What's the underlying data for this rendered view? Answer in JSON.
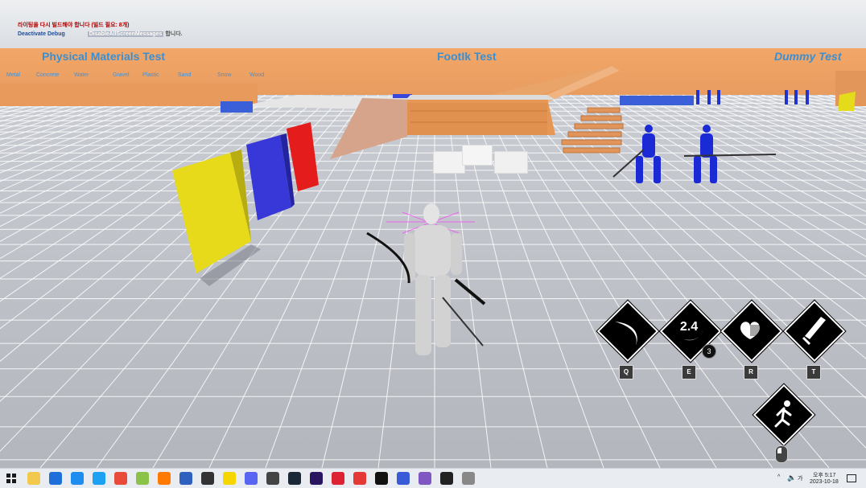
{
  "debug": {
    "rebuild_warning": "라이팅을 다시 빌드해야 합니다 (빌드 필요: 8개)",
    "deactivate_label": "Deactivate Debug",
    "deactivate_tail": "DisableAllScreenMessages",
    "deactivate_suffix": "합니다."
  },
  "zones": {
    "physical": "Physical Materials Test",
    "footik": "FootIk Test",
    "dummy": "Dummy Test"
  },
  "materials": [
    "Metal",
    "Concrete",
    "Water",
    "Gravel",
    "Plastic",
    "Sand",
    "Snow",
    "Wood"
  ],
  "skills": [
    {
      "key": "Q",
      "icon": "slash-icon"
    },
    {
      "key": "E",
      "icon": "moon-slash-icon",
      "timer": "2.4",
      "stack": "3"
    },
    {
      "key": "R",
      "icon": "heart-shield-icon"
    },
    {
      "key": "T",
      "icon": "sword-icon"
    }
  ],
  "sprint": {
    "icon": "running-man-icon",
    "key_icon": "mouse-icon"
  },
  "taskbar": {
    "apps": [
      "file-explorer-icon",
      "edge-icon",
      "edge-dev-icon",
      "twitter-icon",
      "chrome-icon",
      "app-green-icon",
      "search-app-icon",
      "vscode-icon",
      "github-desktop-icon",
      "kakao-icon",
      "discord-icon",
      "video-player-icon",
      "steam-icon",
      "premiere-icon",
      "record-icon",
      "game-app-icon",
      "unreal-icon",
      "blue-app-icon",
      "purple-app-icon",
      "roblox-icon",
      "media-icon"
    ],
    "time": "오후 5:17",
    "date": "2023-10-18"
  },
  "colors": {
    "title_blue": "#3b8fd1",
    "wall_orange": "#e8a064",
    "skill_bg": "#000000"
  }
}
